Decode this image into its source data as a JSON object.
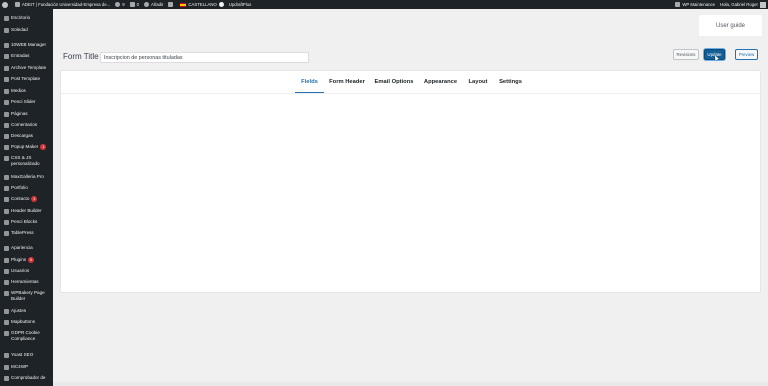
{
  "adminbar": {
    "site_name": "ADEIT | Fundación Universidad-Empresa de...",
    "updates_count": "9",
    "comments_count": "0",
    "new_label": "Añadir",
    "language": "CASTELLANO",
    "plugin": "UpdraftPlus",
    "maintenance": "WP Maintenance",
    "greeting": "Hola, Gabriel Roger"
  },
  "sidebar": {
    "items": [
      {
        "label": "Escritorio",
        "badge": ""
      },
      {
        "label": "Soledad",
        "badge": ""
      },
      {
        "label": "10WEB Manager",
        "badge": ""
      },
      {
        "label": "Entradas",
        "badge": ""
      },
      {
        "label": "Archive Template",
        "badge": ""
      },
      {
        "label": "Post Template",
        "badge": ""
      },
      {
        "label": "Medios",
        "badge": ""
      },
      {
        "label": "Penci Slider",
        "badge": ""
      },
      {
        "label": "Páginas",
        "badge": ""
      },
      {
        "label": "Comentarios",
        "badge": ""
      },
      {
        "label": "Descargas",
        "badge": ""
      },
      {
        "label": "Popup Maker",
        "badge": "1"
      },
      {
        "label": "CSS & JS personalizado",
        "badge": ""
      },
      {
        "label": "MaxGalleria Pro",
        "badge": ""
      },
      {
        "label": "Portfolio",
        "badge": ""
      },
      {
        "label": "Contacto",
        "badge": "1"
      },
      {
        "label": "Header Builder",
        "badge": ""
      },
      {
        "label": "Penci Blocks",
        "badge": ""
      },
      {
        "label": "TablePress",
        "badge": ""
      },
      {
        "label": "Apariencia",
        "badge": ""
      },
      {
        "label": "Plugins",
        "badge": "9"
      },
      {
        "label": "Usuarios",
        "badge": ""
      },
      {
        "label": "Herramientas",
        "badge": ""
      },
      {
        "label": "WPBakery Page Builder",
        "badge": ""
      },
      {
        "label": "Ajustes",
        "badge": ""
      },
      {
        "label": "Mapbuttons",
        "badge": ""
      },
      {
        "label": "GDPR Cookie Compliance",
        "badge": ""
      },
      {
        "label": "Yoast SEO",
        "badge": ""
      },
      {
        "label": "MC4WP",
        "badge": ""
      },
      {
        "label": "Comprobador de",
        "badge": ""
      }
    ]
  },
  "user_guide": "User guide",
  "form": {
    "title_label": "Form Title",
    "title_value": "Inscripcion de personas tituladas"
  },
  "buttons": {
    "revisions": "Revisions",
    "update": "Update",
    "preview": "Preview"
  },
  "tabs": [
    {
      "label": "Fields",
      "active": true
    },
    {
      "label": "Form Header",
      "active": false
    },
    {
      "label": "Email Options",
      "active": false
    },
    {
      "label": "Appearance",
      "active": false
    },
    {
      "label": "Layout",
      "active": false
    },
    {
      "label": "Settings",
      "active": false
    }
  ],
  "colors": {
    "adminbar_bg": "#1d2327",
    "accent": "#2271b1",
    "badge": "#d63638"
  }
}
